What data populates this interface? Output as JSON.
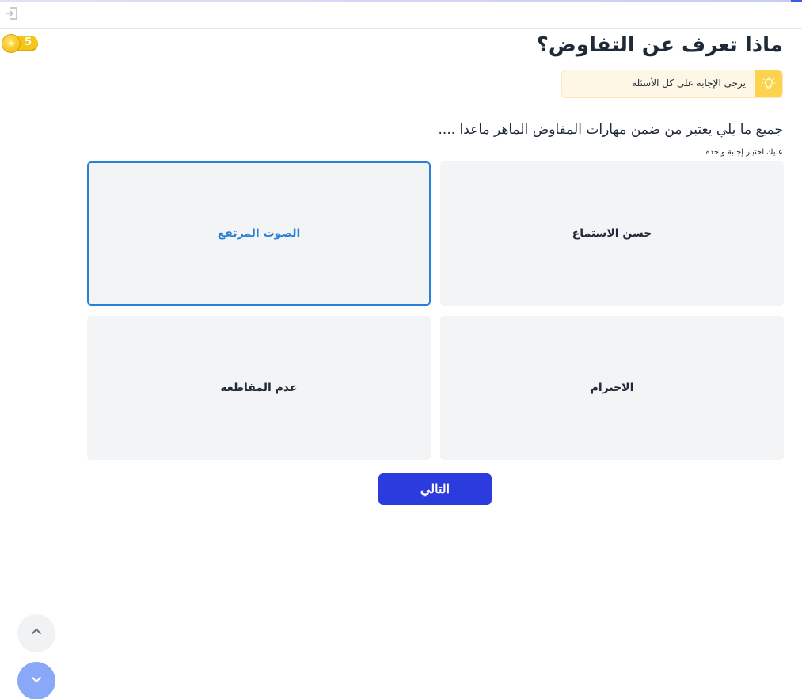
{
  "topbar": {
    "logout_icon": "logout-icon"
  },
  "coins": {
    "count": "5",
    "icon": "star-coin-icon"
  },
  "quiz": {
    "title": "ماذا تعرف عن التفاوض؟",
    "hint": "يرجى الإجابة على كل الأسئلة",
    "hint_icon": "lightbulb-icon",
    "question": "جميع ما يلي يعتبر من ضمن مهارات المفاوض الماهر ماعدا ....",
    "instruction": "عليك اختيار إجابة واحدة",
    "options": [
      {
        "label": "حسن الاستماع",
        "selected": false
      },
      {
        "label": "الصوت المرتفع",
        "selected": true
      },
      {
        "label": "الاحترام",
        "selected": false
      },
      {
        "label": "عدم المقاطعة",
        "selected": false
      }
    ],
    "next_label": "التالي"
  },
  "scroll": {
    "up_icon": "chevron-up-icon",
    "down_icon": "chevron-down-icon"
  },
  "colors": {
    "primary": "#2b3bdd",
    "selected_border": "#2b7fd6",
    "option_bg": "#f3f4f6",
    "hint_bg": "#fef7e6",
    "hint_icon_bg": "#fcd34d",
    "coin": "#f5c518",
    "scroll_down_bg": "#8aa8f8"
  }
}
